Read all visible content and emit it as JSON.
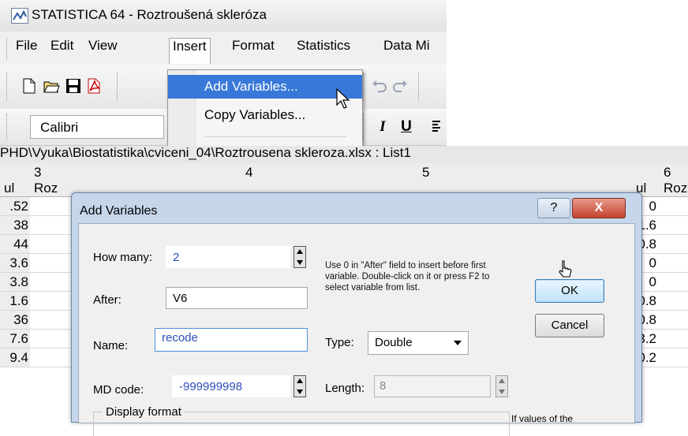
{
  "window": {
    "title": "STATISTICA 64 - Roztroušená skleróza"
  },
  "menubar": {
    "items": [
      "File",
      "Edit",
      "View",
      "Insert",
      "Format",
      "Statistics",
      "Data Mi"
    ]
  },
  "toolbar": {
    "font": "Calibri",
    "italic": "I",
    "underline": "U"
  },
  "insert_menu": {
    "items": [
      "Add Variables...",
      "Copy Variables..."
    ]
  },
  "path": "PHD\\Vyuka\\Biostatistika\\cviceni_04\\Roztrousena skleroza.xlsx : List1",
  "sheet": {
    "columns": [
      {
        "num": "3",
        "sub": "Roz"
      },
      {
        "num": "4",
        "sub": ""
      },
      {
        "num": "5",
        "sub": ""
      },
      {
        "num": "6",
        "sub": "Roz"
      }
    ],
    "left_header_sub": "ul",
    "right_header_sub": "ul",
    "left_values": [
      ".52",
      "38",
      "44",
      "3.6",
      "3.8",
      "1.6",
      "36",
      "7.6",
      "9.4"
    ],
    "right_values": [
      "0",
      "1.6",
      "0.8",
      "0",
      "0",
      "0.8",
      "0.8",
      "3.2",
      "0.2"
    ]
  },
  "dialog": {
    "title": "Add Variables",
    "help_label": "?",
    "close_label": "X",
    "how_many_label": "How many:",
    "how_many_value": "2",
    "after_label": "After:",
    "after_value": "V6",
    "name_label": "Name:",
    "name_value": "recode",
    "md_code_label": "MD code:",
    "md_code_value": "-999999998",
    "help_text": "Use 0 in \"After\" field to insert before first variable. Double-click on it or press F2 to select variable from list.",
    "ok_label": "OK",
    "cancel_label": "Cancel",
    "type_label": "Type:",
    "type_value": "Double",
    "length_label": "Length:",
    "length_value": "8",
    "display_format_label": "Display format",
    "side_note": "If values of the"
  }
}
